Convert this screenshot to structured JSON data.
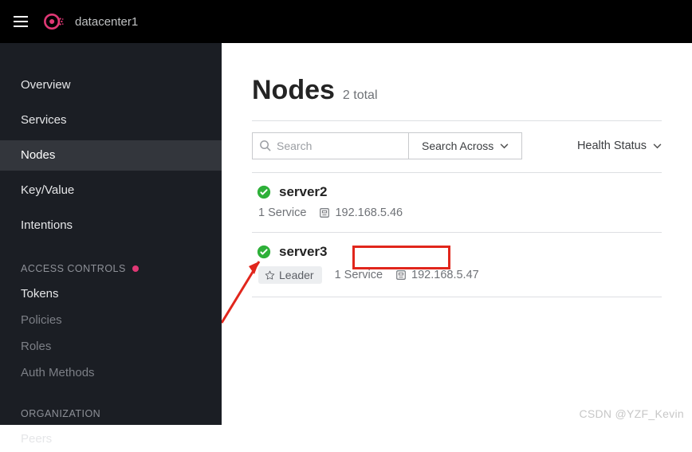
{
  "header": {
    "datacenter": "datacenter1"
  },
  "sidebar": {
    "items": [
      {
        "label": "Overview"
      },
      {
        "label": "Services"
      },
      {
        "label": "Nodes",
        "active": true
      },
      {
        "label": "Key/Value"
      },
      {
        "label": "Intentions"
      }
    ],
    "access_section": "ACCESS CONTROLS",
    "access_items": [
      {
        "label": "Tokens",
        "disabled": false
      },
      {
        "label": "Policies",
        "disabled": true
      },
      {
        "label": "Roles",
        "disabled": true
      },
      {
        "label": "Auth Methods",
        "disabled": true
      }
    ],
    "org_section": "ORGANIZATION",
    "org_items": [
      {
        "label": "Peers"
      }
    ]
  },
  "page": {
    "title": "Nodes",
    "count": "2 total"
  },
  "filters": {
    "search_placeholder": "Search",
    "search_across_label": "Search Across",
    "health_status_label": "Health Status"
  },
  "nodes": [
    {
      "name": "server2",
      "services": "1 Service",
      "ip": "192.168.5.46",
      "leader": false
    },
    {
      "name": "server3",
      "leader_label": "Leader",
      "services": "1 Service",
      "ip": "192.168.5.47",
      "leader": true
    }
  ],
  "watermark": "CSDN @YZF_Kevin"
}
